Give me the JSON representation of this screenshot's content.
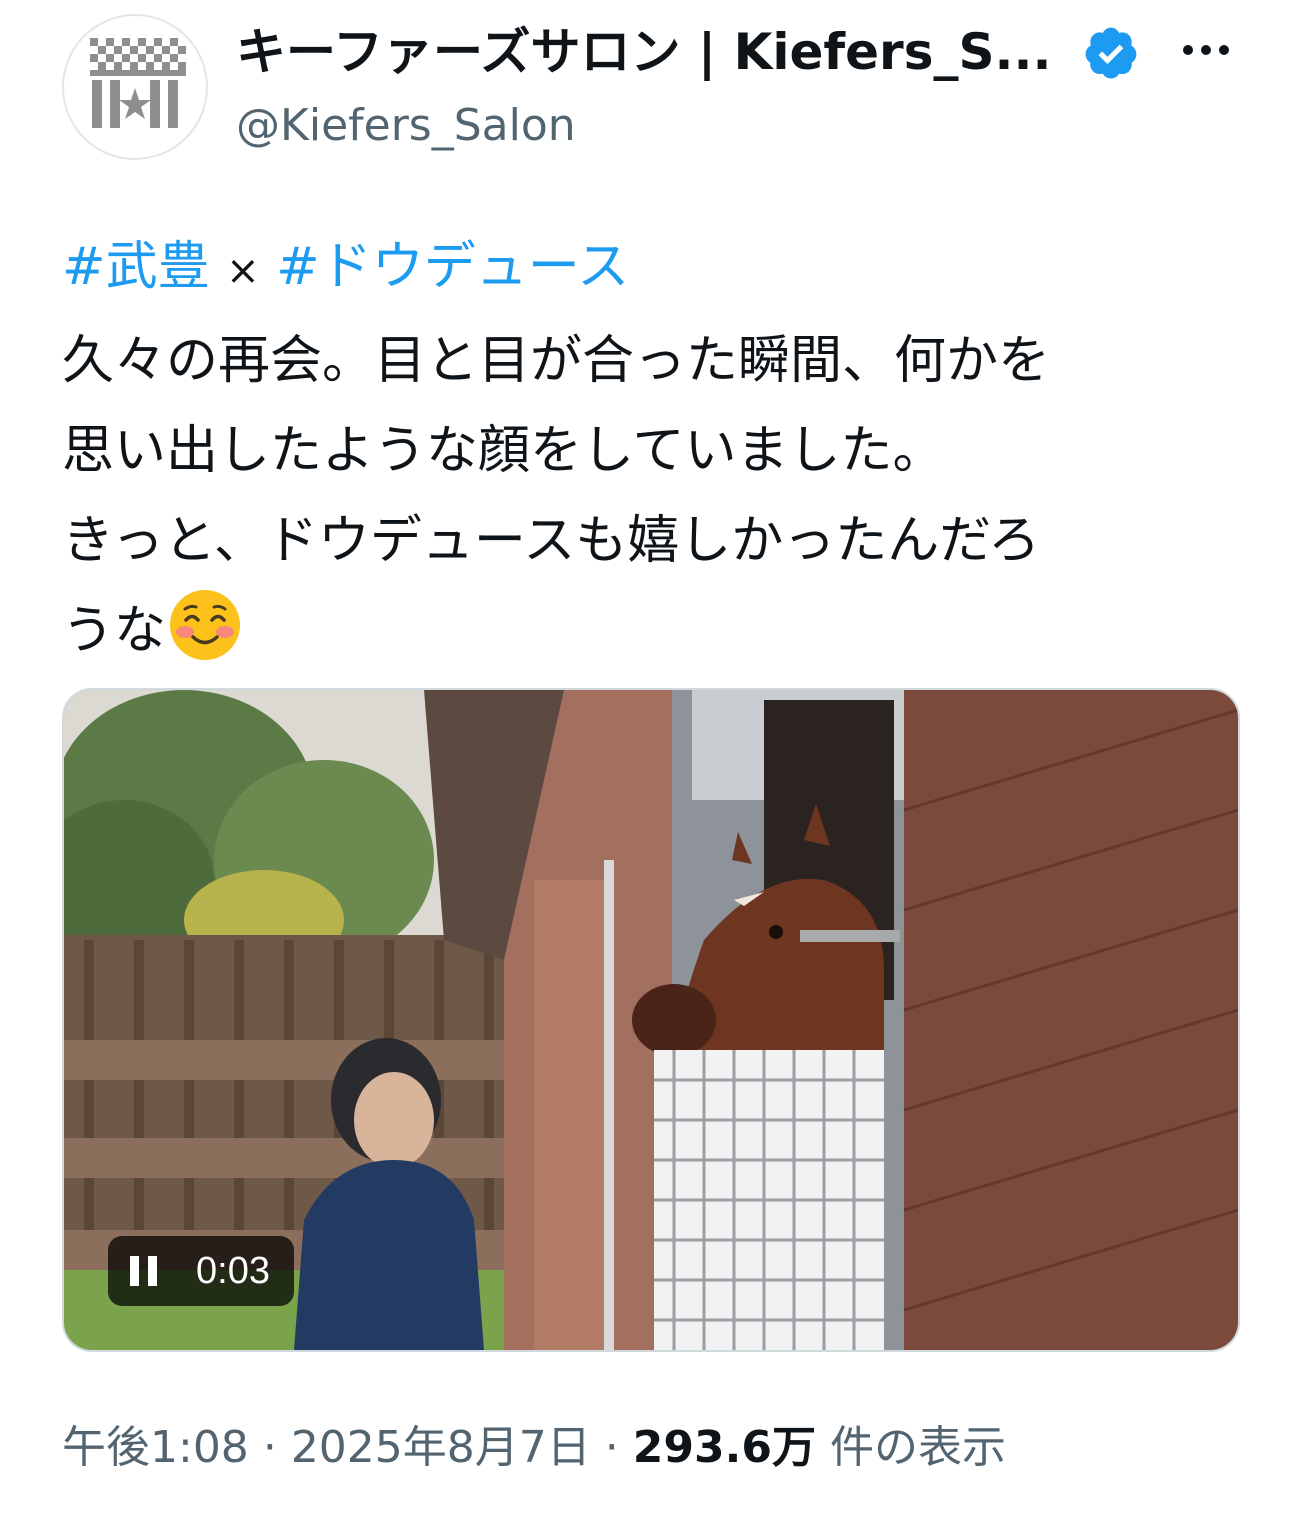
{
  "author": {
    "display_name": "キーファーズサロン | Kiefers_S...",
    "handle": "@Kiefers_Salon",
    "verified": true,
    "avatar_icon": "kiefers-logo-icon",
    "verified_icon": "verified-badge-icon",
    "more_icon": "more-options-icon"
  },
  "tweet": {
    "hashtag_1": "#武豊",
    "separator": "×",
    "hashtag_2": "#ドウデュース",
    "line_1": "久々の再会。目と目が合った瞬間、何かを",
    "line_2": "思い出したような顔をしていました。",
    "line_3": "きっと、ドウデュースも嬉しかったんだろ",
    "line_4": "うな",
    "emoji_icon": "smiling-blush-emoji-icon"
  },
  "video": {
    "elapsed": "0:03",
    "pause_icon": "pause-icon"
  },
  "meta": {
    "time": "午後1:08",
    "dot_1": "·",
    "date": "2025年8月7日",
    "dot_2": "·",
    "views_count": "293.6万",
    "views_label": "件の表示"
  },
  "colors": {
    "hashtag": "#1d9bf0",
    "verified": "#1d9bf0",
    "secondary_text": "#536471",
    "primary_text": "#0f1419"
  }
}
